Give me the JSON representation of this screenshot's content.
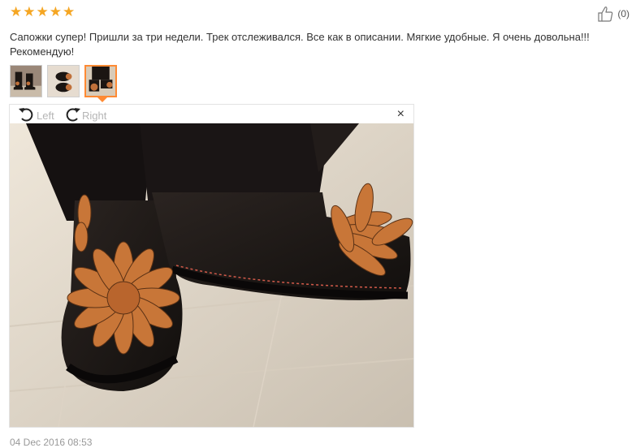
{
  "review": {
    "rating_stars": 5,
    "likes_count": "(0)",
    "text": "Сапожки супер! Пришли за три недели. Трек отслеживался. Все как в описании. Мягкие удобные. Я очень довольна!!! Рекомендую!",
    "date": "04 Dec 2016 08:53"
  },
  "thumbnails": [
    {
      "name": "photo-1",
      "selected": false
    },
    {
      "name": "photo-2",
      "selected": false
    },
    {
      "name": "photo-3",
      "selected": true
    }
  ],
  "viewer": {
    "rotate_left_label": "Left",
    "rotate_right_label": "Right",
    "close_icon": "×"
  },
  "colors": {
    "star": "#f5a623",
    "selected_thumb_border": "#ff8a33"
  }
}
